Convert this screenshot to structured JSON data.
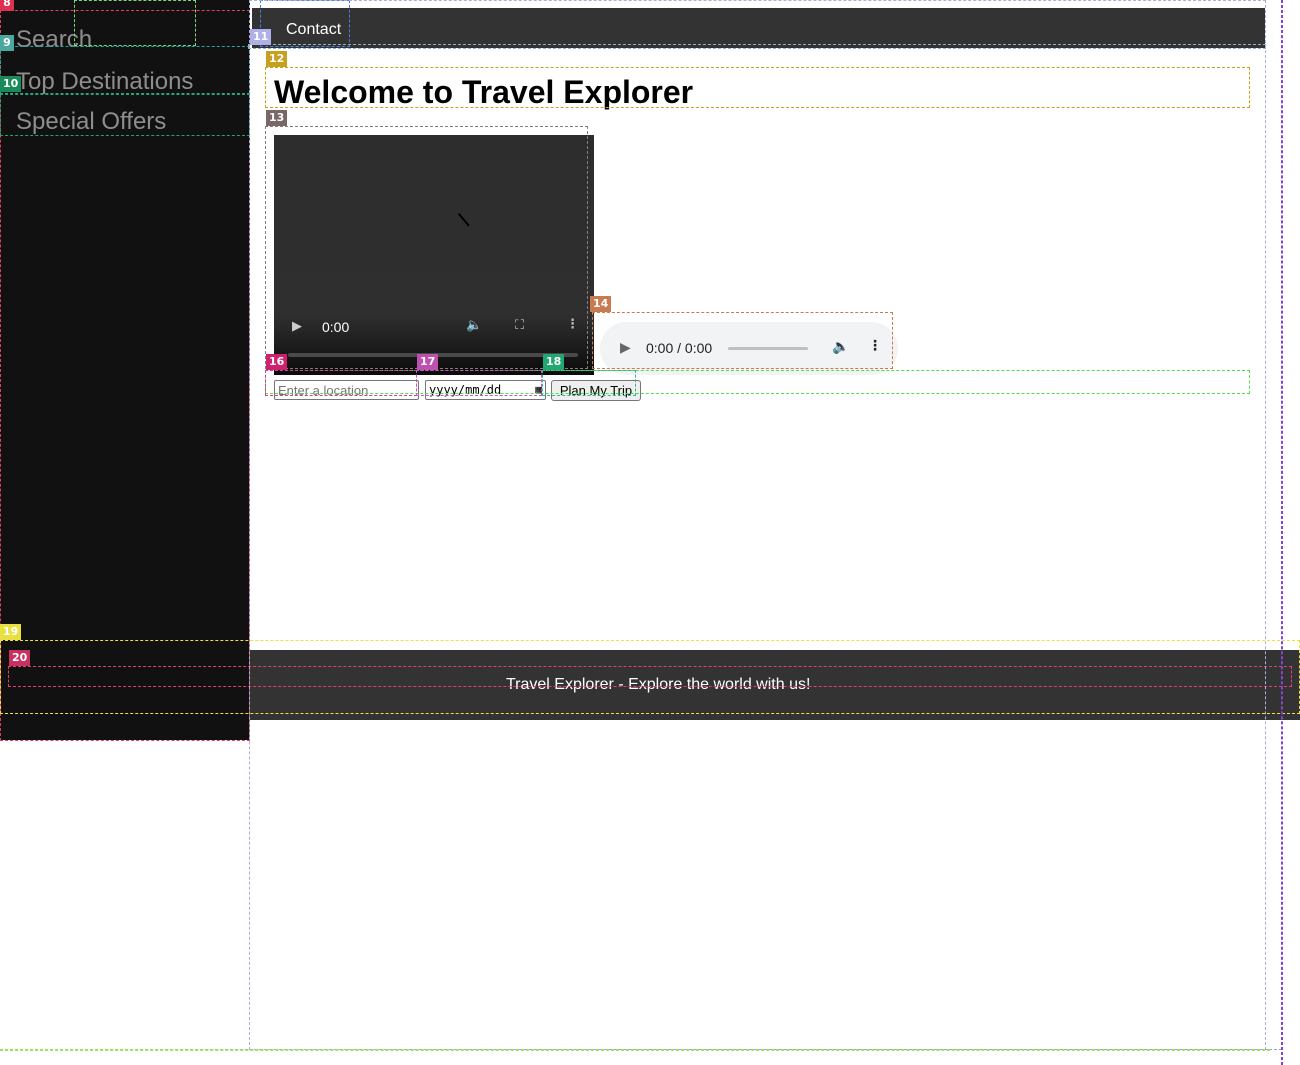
{
  "sidebar": {
    "items": [
      {
        "label": "Search"
      },
      {
        "label": "Top Destinations"
      },
      {
        "label": "Special Offers"
      }
    ]
  },
  "nav": {
    "contact_label": "Contact"
  },
  "main": {
    "heading": "Welcome to Travel Explorer",
    "video": {
      "time": "0:00"
    },
    "audio": {
      "time": "0:00 / 0:00"
    },
    "form": {
      "location_placeholder": "Enter a location",
      "date_placeholder": "yyyy/mm/dd",
      "submit_label": "Plan My Trip"
    }
  },
  "footer": {
    "text": "Travel Explorer - Explore the world with us!"
  },
  "overlay": {
    "badges": [
      "8",
      "9",
      "10",
      "11",
      "12",
      "13",
      "14",
      "16",
      "17",
      "18",
      "19",
      "20"
    ]
  },
  "colors": {
    "sidebar_bg": "#111111",
    "nav_bg": "#333333",
    "footer_bg": "#333333"
  }
}
